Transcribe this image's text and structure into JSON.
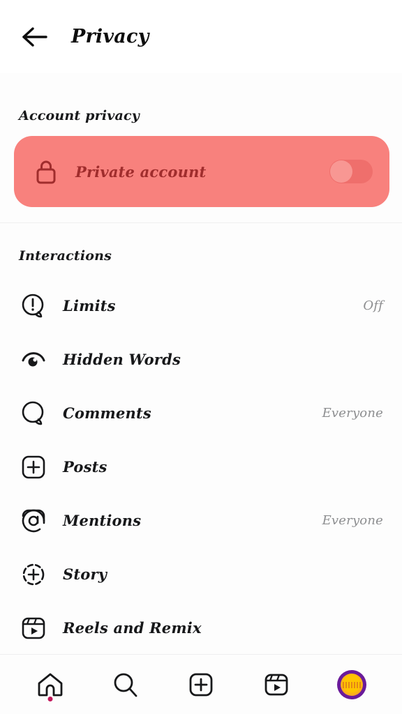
{
  "header": {
    "title": "Privacy",
    "back_icon": "arrow-left-icon"
  },
  "account_privacy": {
    "section_label": "Account privacy",
    "private_account": {
      "label": "Private account",
      "icon": "lock-icon",
      "toggle_state": "off",
      "highlight_color": "#f8817d",
      "text_color": "#a02d2d"
    }
  },
  "interactions": {
    "section_label": "Interactions",
    "items": [
      {
        "label": "Limits",
        "value": "Off",
        "icon": "exclamation-bubble-icon"
      },
      {
        "label": "Hidden Words",
        "value": "",
        "icon": "eye-icon"
      },
      {
        "label": "Comments",
        "value": "Everyone",
        "icon": "comment-bubble-icon"
      },
      {
        "label": "Posts",
        "value": "",
        "icon": "plus-square-icon"
      },
      {
        "label": "Mentions",
        "value": "Everyone",
        "icon": "at-square-icon"
      },
      {
        "label": "Story",
        "value": "",
        "icon": "story-plus-icon"
      },
      {
        "label": "Reels and Remix",
        "value": "",
        "icon": "reels-icon"
      }
    ]
  },
  "bottom_nav": {
    "items": [
      {
        "name": "home",
        "icon": "home-icon",
        "has_dot": true
      },
      {
        "name": "search",
        "icon": "search-icon",
        "has_dot": false
      },
      {
        "name": "create",
        "icon": "plus-square-icon",
        "has_dot": false
      },
      {
        "name": "reels",
        "icon": "reels-icon",
        "has_dot": false
      },
      {
        "name": "profile",
        "icon": "avatar-icon",
        "has_dot": false
      }
    ],
    "dot_color": "#c2185b",
    "avatar_ring_color": "#6a1b9a",
    "avatar_fill_color": "#ffc400"
  }
}
